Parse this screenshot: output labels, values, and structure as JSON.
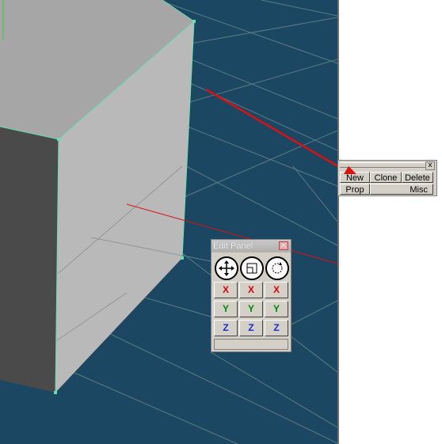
{
  "toolbar": {
    "new_label": "New",
    "clone_label": "Clone",
    "delete_label": "Delete",
    "prop_label": "Prop",
    "misc_label": "Misc",
    "close_glyph": "x"
  },
  "edit_panel": {
    "title": "Edit Panel",
    "close_glyph": "×",
    "tools": [
      "move-tool-icon",
      "scale-tool-icon",
      "rotate-tool-icon"
    ],
    "rows": [
      {
        "axis": "X",
        "color": "#e00000"
      },
      {
        "axis": "Y",
        "color": "#008a00"
      },
      {
        "axis": "Z",
        "color": "#1030d0"
      }
    ]
  },
  "colors": {
    "viewport_bg": "#1b4762",
    "grid": "#8fa8a0",
    "selection": "#66e0b0",
    "annotation_arrow": "#dd1010",
    "cube_top": "#a6a6a6",
    "cube_front": "#b9b9b9",
    "cube_side": "#4a4a4a"
  }
}
